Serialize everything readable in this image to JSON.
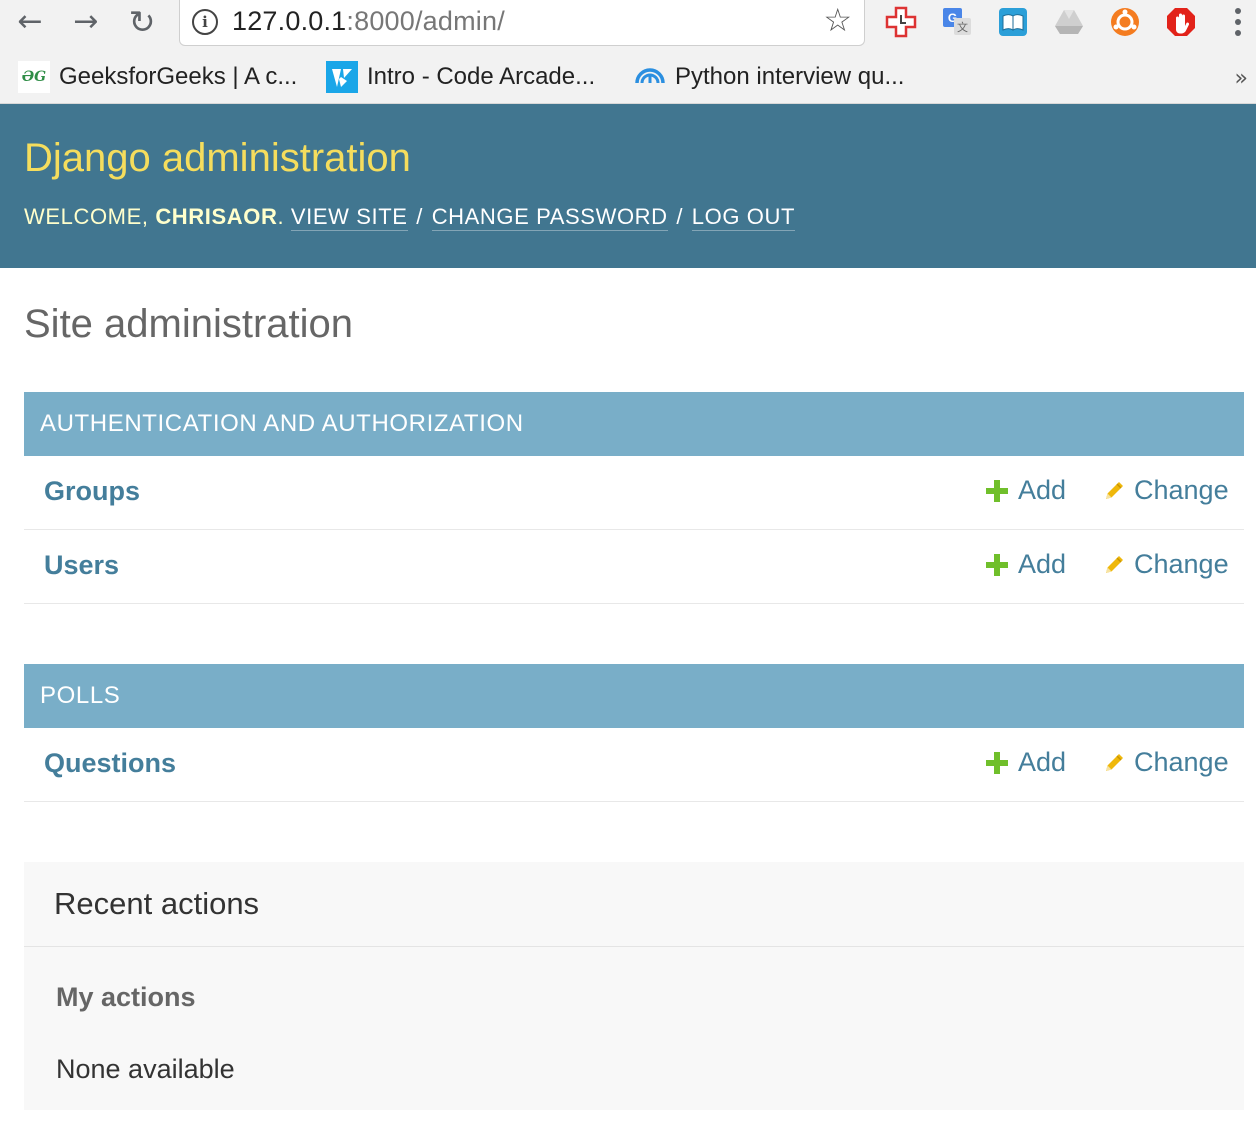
{
  "browser": {
    "url_host": "127.0.0.1",
    "url_path": ":8000/admin/",
    "bookmarks": [
      {
        "label": "GeeksforGeeks | A c...",
        "icon": "geeksforgeeks-icon",
        "icon_text": "ƏG"
      },
      {
        "label": "Intro - Code Arcade...",
        "icon": "codesignal-icon"
      },
      {
        "label": "Python interview qu...",
        "icon": "rainbow-umbrella-icon"
      }
    ],
    "overflow": "»"
  },
  "header": {
    "branding": "Django administration",
    "welcome": "Welcome,",
    "username": "chrisaor",
    "links": {
      "view_site": "View site",
      "change_password": "Change password",
      "log_out": "Log out"
    },
    "separator": "/",
    "accent_color": "#f5dd5d",
    "bg_color": "#417690"
  },
  "content": {
    "title": "Site administration",
    "modules": [
      {
        "caption": "Authentication and Authorization",
        "models": [
          {
            "name": "Groups",
            "add": "Add",
            "change": "Change"
          },
          {
            "name": "Users",
            "add": "Add",
            "change": "Change"
          }
        ]
      },
      {
        "caption": "Polls",
        "models": [
          {
            "name": "Questions",
            "add": "Add",
            "change": "Change"
          }
        ]
      }
    ],
    "caption_color": "#79aec8",
    "link_color": "#447e9b"
  },
  "recent_actions": {
    "title": "Recent actions",
    "subtitle": "My actions",
    "empty": "None available"
  }
}
